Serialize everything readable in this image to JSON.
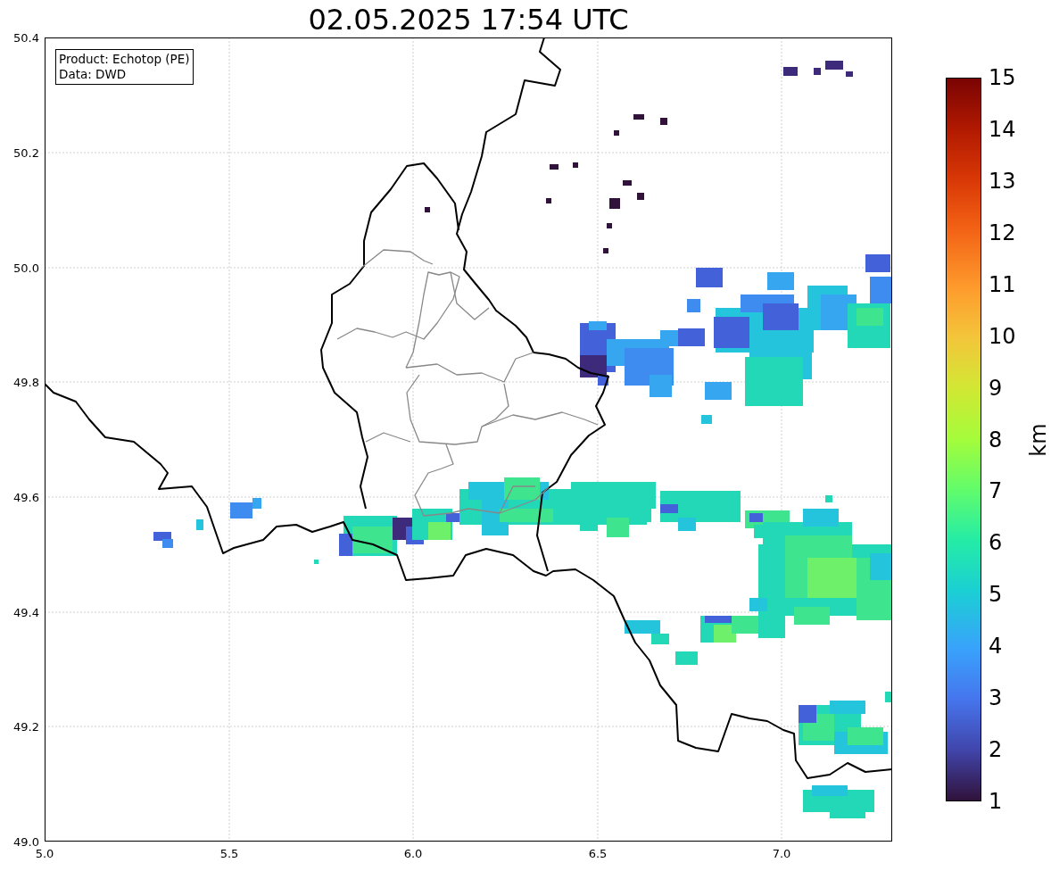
{
  "title": "02.05.2025 17:54 UTC",
  "info_box": {
    "lines": [
      "Product: Echotop (PE)",
      "Data: DWD"
    ]
  },
  "plot": {
    "x_ticks": [
      "5.0",
      "5.5",
      "6.0",
      "6.5",
      "7.0"
    ],
    "y_ticks": [
      "50.4",
      "50.2",
      "50.0",
      "49.8",
      "49.6",
      "49.4",
      "49.2",
      "49.0"
    ]
  },
  "colorbar": {
    "label": "km",
    "ticks": [
      "15",
      "14",
      "13",
      "12",
      "11",
      "10",
      "9",
      "8",
      "7",
      "6",
      "5",
      "4",
      "3",
      "2",
      "1"
    ]
  }
}
